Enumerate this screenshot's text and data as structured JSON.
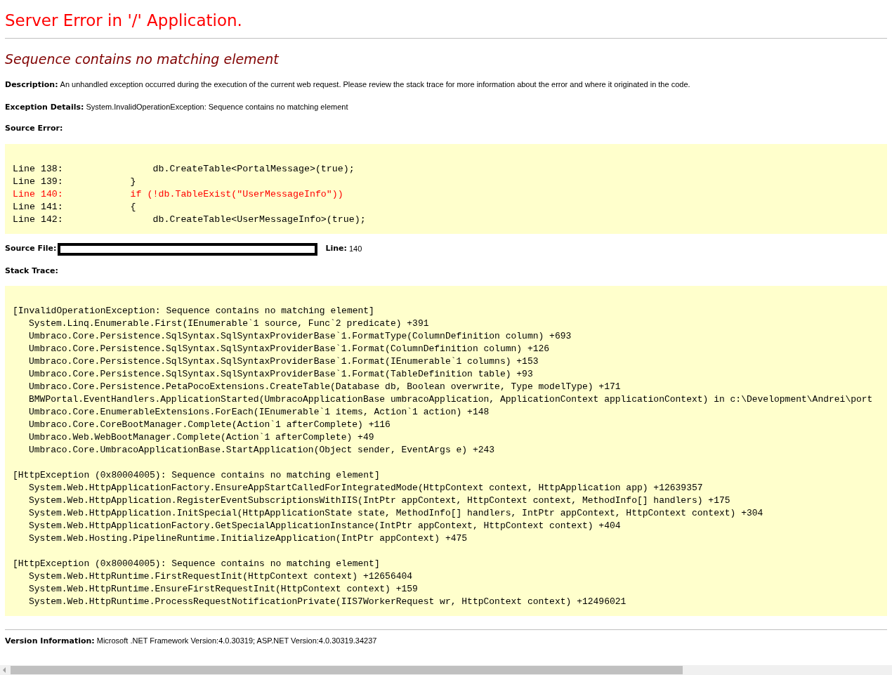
{
  "title": "Server Error in '/' Application.",
  "error_message": "Sequence contains no matching element",
  "description": {
    "label": "Description:",
    "text": "An unhandled exception occurred during the execution of the current web request. Please review the stack trace for more information about the error and where it originated in the code."
  },
  "exception_details": {
    "label": "Exception Details:",
    "text": "System.InvalidOperationException: Sequence contains no matching element"
  },
  "source_error": {
    "label": "Source Error:",
    "lines": [
      {
        "text": "Line 138:                db.CreateTable<PortalMessage>(true);",
        "highlighted": false
      },
      {
        "text": "Line 139:            }",
        "highlighted": false
      },
      {
        "text": "Line 140:            if (!db.TableExist(\"UserMessageInfo\"))",
        "highlighted": true
      },
      {
        "text": "Line 141:            {",
        "highlighted": false
      },
      {
        "text": "Line 142:                db.CreateTable<UserMessageInfo>(true);",
        "highlighted": false
      }
    ]
  },
  "source_file": {
    "label": "Source File:",
    "line_label": "Line:",
    "line_value": "140"
  },
  "stack_trace": {
    "label": "Stack Trace:",
    "sections": [
      {
        "header": "[InvalidOperationException: Sequence contains no matching element]",
        "frames": [
          "System.Linq.Enumerable.First(IEnumerable`1 source, Func`2 predicate) +391",
          "Umbraco.Core.Persistence.SqlSyntax.SqlSyntaxProviderBase`1.FormatType(ColumnDefinition column) +693",
          "Umbraco.Core.Persistence.SqlSyntax.SqlSyntaxProviderBase`1.Format(ColumnDefinition column) +126",
          "Umbraco.Core.Persistence.SqlSyntax.SqlSyntaxProviderBase`1.Format(IEnumerable`1 columns) +153",
          "Umbraco.Core.Persistence.SqlSyntax.SqlSyntaxProviderBase`1.Format(TableDefinition table) +93",
          "Umbraco.Core.Persistence.PetaPocoExtensions.CreateTable(Database db, Boolean overwrite, Type modelType) +171",
          "BMWPortal.EventHandlers.ApplicationStarted(UmbracoApplicationBase umbracoApplication, ApplicationContext applicationContext) in c:\\Development\\Andrei\\port",
          "Umbraco.Core.EnumerableExtensions.ForEach(IEnumerable`1 items, Action`1 action) +148",
          "Umbraco.Core.CoreBootManager.Complete(Action`1 afterComplete) +116",
          "Umbraco.Web.WebBootManager.Complete(Action`1 afterComplete) +49",
          "Umbraco.Core.UmbracoApplicationBase.StartApplication(Object sender, EventArgs e) +243"
        ]
      },
      {
        "header": "[HttpException (0x80004005): Sequence contains no matching element]",
        "frames": [
          "System.Web.HttpApplicationFactory.EnsureAppStartCalledForIntegratedMode(HttpContext context, HttpApplication app) +12639357",
          "System.Web.HttpApplication.RegisterEventSubscriptionsWithIIS(IntPtr appContext, HttpContext context, MethodInfo[] handlers) +175",
          "System.Web.HttpApplication.InitSpecial(HttpApplicationState state, MethodInfo[] handlers, IntPtr appContext, HttpContext context) +304",
          "System.Web.HttpApplicationFactory.GetSpecialApplicationInstance(IntPtr appContext, HttpContext context) +404",
          "System.Web.Hosting.PipelineRuntime.InitializeApplication(IntPtr appContext) +475"
        ]
      },
      {
        "header": "[HttpException (0x80004005): Sequence contains no matching element]",
        "frames": [
          "System.Web.HttpRuntime.FirstRequestInit(HttpContext context) +12656404",
          "System.Web.HttpRuntime.EnsureFirstRequestInit(HttpContext context) +159",
          "System.Web.HttpRuntime.ProcessRequestNotificationPrivate(IIS7WorkerRequest wr, HttpContext context) +12496021"
        ]
      }
    ]
  },
  "version_information": {
    "label": "Version Information:",
    "text": "Microsoft .NET Framework Version:4.0.30319; ASP.NET Version:4.0.30319.34237"
  }
}
